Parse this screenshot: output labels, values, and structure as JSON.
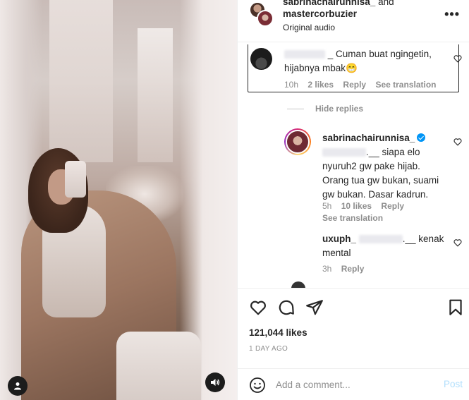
{
  "header": {
    "user1": "sabrinachairunnisa_",
    "and": "and",
    "user2": "mastercorbuzier",
    "audio": "Original audio"
  },
  "comments": [
    {
      "text": "_ Cuman buat ngingetin, hijabnya mbak😁",
      "time": "10h",
      "likes": "2 likes",
      "reply": "Reply",
      "translate": "See translation"
    },
    {
      "hide_replies": "Hide replies"
    },
    {
      "username": "sabrinachairunnisa_",
      "text": ".__ siapa elo nyuruh2 gw pake hijab. Orang tua gw bukan, suami gw bukan. Dasar kadrun.",
      "time": "5h",
      "likes": "10 likes",
      "reply": "Reply",
      "translate": "See translation"
    },
    {
      "username": "uxuph_",
      "text": ".__ kenak mental",
      "time": "3h",
      "reply": "Reply"
    }
  ],
  "post": {
    "likes": "121,044 likes",
    "date": "1 DAY AGO"
  },
  "composer": {
    "placeholder": "Add a comment...",
    "post_label": "Post"
  },
  "colors": {
    "link_blue_disabled": "#b2dffc",
    "verified": "#0095f6",
    "muted": "#8e8e8e"
  },
  "icons": [
    "user-tag-icon",
    "audio-icon",
    "more-icon",
    "heart-icon",
    "comment-icon",
    "share-icon",
    "bookmark-icon",
    "emoji-icon",
    "verified-icon"
  ]
}
